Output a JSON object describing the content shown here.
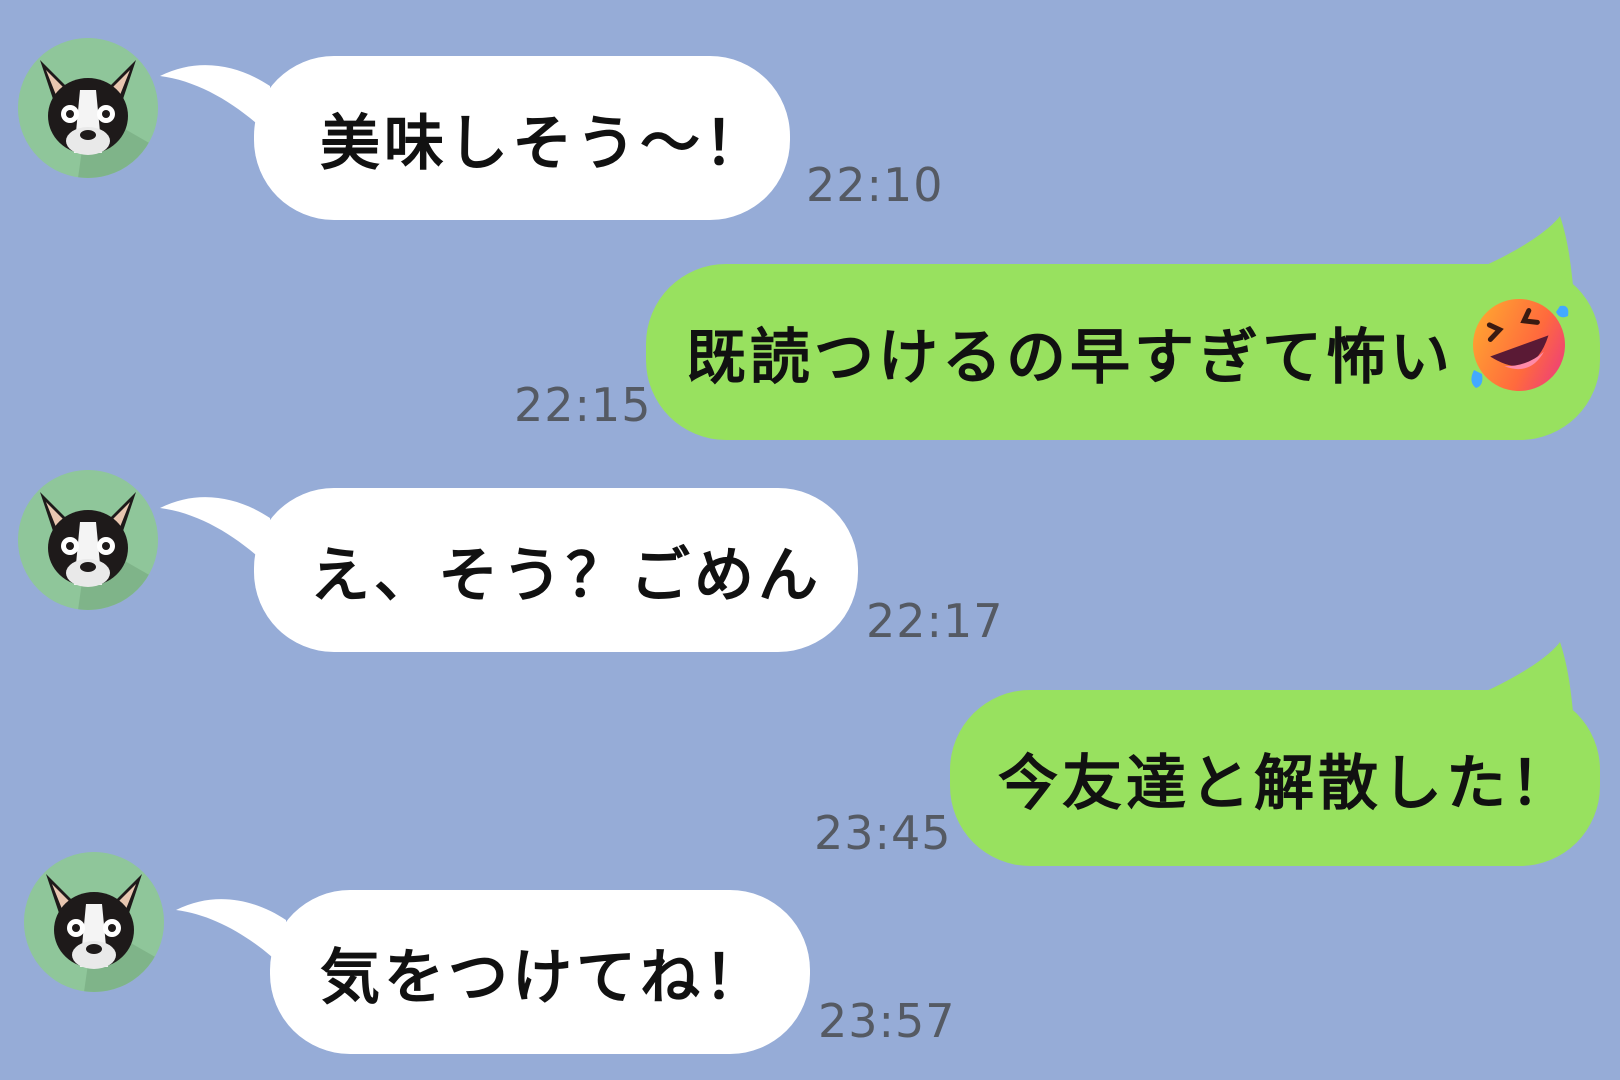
{
  "colors": {
    "background": "#96acd7",
    "incoming_bubble": "#ffffff",
    "outgoing_bubble": "#98e15f",
    "timestamp": "#555a63",
    "avatar_bg": "#8fc69a"
  },
  "messages": [
    {
      "direction": "incoming",
      "avatar": "french-bulldog-icon",
      "text": "美味しそう〜！",
      "time": "22:10"
    },
    {
      "direction": "outgoing",
      "text": "既読つけるの早すぎて怖い",
      "emoji": "rolling-on-floor-laughing-icon",
      "time": "22:15"
    },
    {
      "direction": "incoming",
      "avatar": "french-bulldog-icon",
      "text": "え、そう？ごめん",
      "time": "22:17"
    },
    {
      "direction": "outgoing",
      "text": "今友達と解散した！",
      "time": "23:45"
    },
    {
      "direction": "incoming",
      "avatar": "french-bulldog-icon",
      "text": "気をつけてね！",
      "time": "23:57"
    }
  ]
}
